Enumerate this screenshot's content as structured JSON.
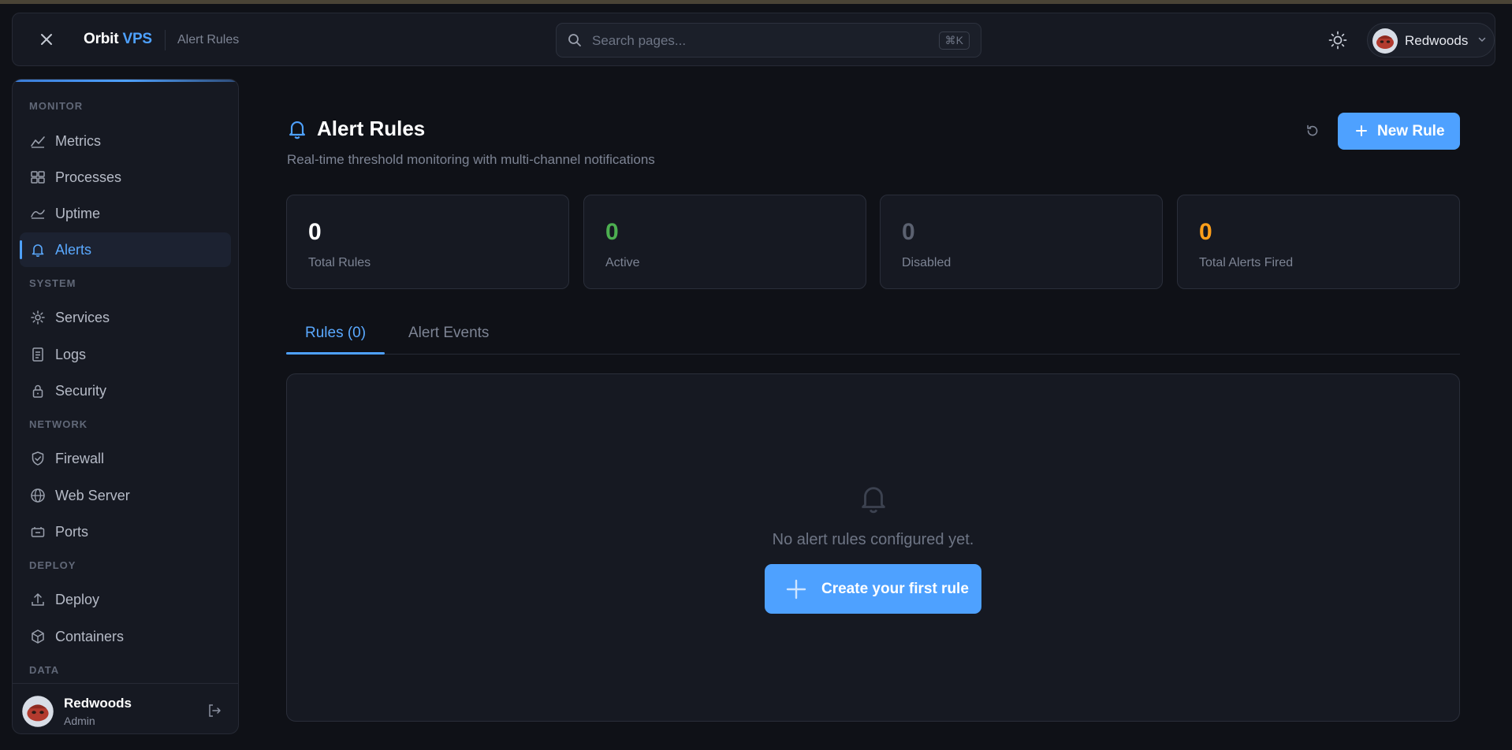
{
  "header": {
    "brand_name": "Orbit",
    "brand_accent": "VPS",
    "breadcrumb": "Alert Rules",
    "search_placeholder": "Search pages...",
    "search_shortcut": "⌘K",
    "user_name": "Redwoods"
  },
  "sidebar": {
    "sections": {
      "monitor": "MONITOR",
      "system": "SYSTEM",
      "network": "NETWORK",
      "deploy": "DEPLOY",
      "data": "DATA"
    },
    "items": [
      {
        "label": "Metrics",
        "icon": "chart-line-icon"
      },
      {
        "label": "Processes",
        "icon": "grid-icon"
      },
      {
        "label": "Uptime",
        "icon": "uptime-icon"
      },
      {
        "label": "Alerts",
        "icon": "bell-icon",
        "active": true
      },
      {
        "label": "Services",
        "icon": "gear-icon"
      },
      {
        "label": "Logs",
        "icon": "document-icon"
      },
      {
        "label": "Security",
        "icon": "lock-icon"
      },
      {
        "label": "Firewall",
        "icon": "shield-icon"
      },
      {
        "label": "Web Server",
        "icon": "globe-icon"
      },
      {
        "label": "Ports",
        "icon": "port-icon"
      },
      {
        "label": "Deploy",
        "icon": "deploy-icon"
      },
      {
        "label": "Containers",
        "icon": "box-icon"
      }
    ],
    "footer": {
      "name": "Redwoods",
      "role": "Admin"
    }
  },
  "main": {
    "title": "Alert Rules",
    "subtitle": "Real-time threshold monitoring with multi-channel notifications",
    "new_rule_label": "New Rule",
    "stats": [
      {
        "value": "0",
        "label": "Total Rules",
        "color": "#ffffff"
      },
      {
        "value": "0",
        "label": "Active",
        "color": "#4caf50"
      },
      {
        "value": "0",
        "label": "Disabled",
        "color": "#5b6170"
      },
      {
        "value": "0",
        "label": "Total Alerts Fired",
        "color": "#ff9f1a"
      }
    ],
    "tabs": [
      {
        "label": "Rules (0)",
        "active": true
      },
      {
        "label": "Alert Events",
        "active": false
      }
    ],
    "empty_state": {
      "message": "No alert rules configured yet.",
      "button_label": "Create your first rule"
    }
  },
  "colors": {
    "accent": "#4ea1ff",
    "background": "#0f1117",
    "panel": "#161922"
  }
}
